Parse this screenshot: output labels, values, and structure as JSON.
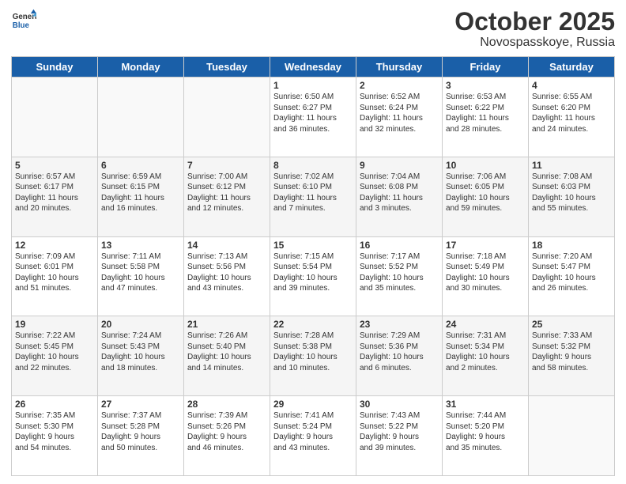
{
  "header": {
    "logo_line1": "General",
    "logo_line2": "Blue",
    "month": "October 2025",
    "location": "Novospasskoye, Russia"
  },
  "weekdays": [
    "Sunday",
    "Monday",
    "Tuesday",
    "Wednesday",
    "Thursday",
    "Friday",
    "Saturday"
  ],
  "weeks": [
    [
      {
        "day": "",
        "info": ""
      },
      {
        "day": "",
        "info": ""
      },
      {
        "day": "",
        "info": ""
      },
      {
        "day": "1",
        "info": "Sunrise: 6:50 AM\nSunset: 6:27 PM\nDaylight: 11 hours\nand 36 minutes."
      },
      {
        "day": "2",
        "info": "Sunrise: 6:52 AM\nSunset: 6:24 PM\nDaylight: 11 hours\nand 32 minutes."
      },
      {
        "day": "3",
        "info": "Sunrise: 6:53 AM\nSunset: 6:22 PM\nDaylight: 11 hours\nand 28 minutes."
      },
      {
        "day": "4",
        "info": "Sunrise: 6:55 AM\nSunset: 6:20 PM\nDaylight: 11 hours\nand 24 minutes."
      }
    ],
    [
      {
        "day": "5",
        "info": "Sunrise: 6:57 AM\nSunset: 6:17 PM\nDaylight: 11 hours\nand 20 minutes."
      },
      {
        "day": "6",
        "info": "Sunrise: 6:59 AM\nSunset: 6:15 PM\nDaylight: 11 hours\nand 16 minutes."
      },
      {
        "day": "7",
        "info": "Sunrise: 7:00 AM\nSunset: 6:12 PM\nDaylight: 11 hours\nand 12 minutes."
      },
      {
        "day": "8",
        "info": "Sunrise: 7:02 AM\nSunset: 6:10 PM\nDaylight: 11 hours\nand 7 minutes."
      },
      {
        "day": "9",
        "info": "Sunrise: 7:04 AM\nSunset: 6:08 PM\nDaylight: 11 hours\nand 3 minutes."
      },
      {
        "day": "10",
        "info": "Sunrise: 7:06 AM\nSunset: 6:05 PM\nDaylight: 10 hours\nand 59 minutes."
      },
      {
        "day": "11",
        "info": "Sunrise: 7:08 AM\nSunset: 6:03 PM\nDaylight: 10 hours\nand 55 minutes."
      }
    ],
    [
      {
        "day": "12",
        "info": "Sunrise: 7:09 AM\nSunset: 6:01 PM\nDaylight: 10 hours\nand 51 minutes."
      },
      {
        "day": "13",
        "info": "Sunrise: 7:11 AM\nSunset: 5:58 PM\nDaylight: 10 hours\nand 47 minutes."
      },
      {
        "day": "14",
        "info": "Sunrise: 7:13 AM\nSunset: 5:56 PM\nDaylight: 10 hours\nand 43 minutes."
      },
      {
        "day": "15",
        "info": "Sunrise: 7:15 AM\nSunset: 5:54 PM\nDaylight: 10 hours\nand 39 minutes."
      },
      {
        "day": "16",
        "info": "Sunrise: 7:17 AM\nSunset: 5:52 PM\nDaylight: 10 hours\nand 35 minutes."
      },
      {
        "day": "17",
        "info": "Sunrise: 7:18 AM\nSunset: 5:49 PM\nDaylight: 10 hours\nand 30 minutes."
      },
      {
        "day": "18",
        "info": "Sunrise: 7:20 AM\nSunset: 5:47 PM\nDaylight: 10 hours\nand 26 minutes."
      }
    ],
    [
      {
        "day": "19",
        "info": "Sunrise: 7:22 AM\nSunset: 5:45 PM\nDaylight: 10 hours\nand 22 minutes."
      },
      {
        "day": "20",
        "info": "Sunrise: 7:24 AM\nSunset: 5:43 PM\nDaylight: 10 hours\nand 18 minutes."
      },
      {
        "day": "21",
        "info": "Sunrise: 7:26 AM\nSunset: 5:40 PM\nDaylight: 10 hours\nand 14 minutes."
      },
      {
        "day": "22",
        "info": "Sunrise: 7:28 AM\nSunset: 5:38 PM\nDaylight: 10 hours\nand 10 minutes."
      },
      {
        "day": "23",
        "info": "Sunrise: 7:29 AM\nSunset: 5:36 PM\nDaylight: 10 hours\nand 6 minutes."
      },
      {
        "day": "24",
        "info": "Sunrise: 7:31 AM\nSunset: 5:34 PM\nDaylight: 10 hours\nand 2 minutes."
      },
      {
        "day": "25",
        "info": "Sunrise: 7:33 AM\nSunset: 5:32 PM\nDaylight: 9 hours\nand 58 minutes."
      }
    ],
    [
      {
        "day": "26",
        "info": "Sunrise: 7:35 AM\nSunset: 5:30 PM\nDaylight: 9 hours\nand 54 minutes."
      },
      {
        "day": "27",
        "info": "Sunrise: 7:37 AM\nSunset: 5:28 PM\nDaylight: 9 hours\nand 50 minutes."
      },
      {
        "day": "28",
        "info": "Sunrise: 7:39 AM\nSunset: 5:26 PM\nDaylight: 9 hours\nand 46 minutes."
      },
      {
        "day": "29",
        "info": "Sunrise: 7:41 AM\nSunset: 5:24 PM\nDaylight: 9 hours\nand 43 minutes."
      },
      {
        "day": "30",
        "info": "Sunrise: 7:43 AM\nSunset: 5:22 PM\nDaylight: 9 hours\nand 39 minutes."
      },
      {
        "day": "31",
        "info": "Sunrise: 7:44 AM\nSunset: 5:20 PM\nDaylight: 9 hours\nand 35 minutes."
      },
      {
        "day": "",
        "info": ""
      }
    ]
  ]
}
